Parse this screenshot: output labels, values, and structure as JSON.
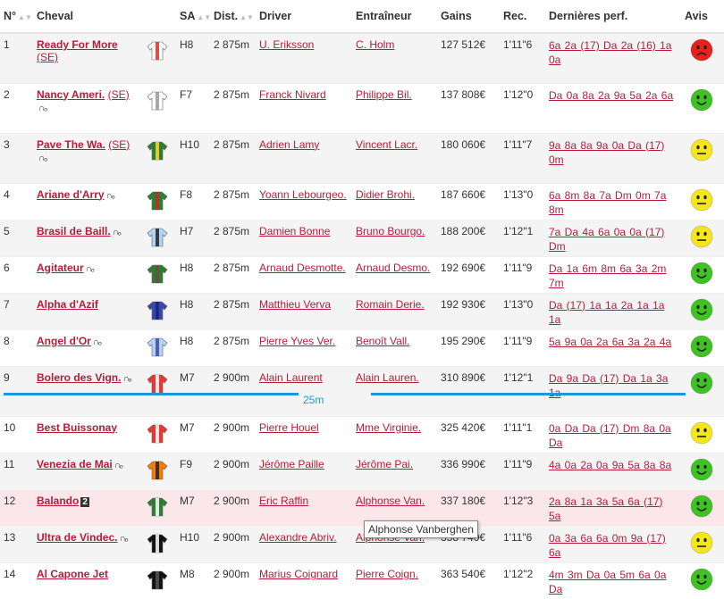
{
  "headers": {
    "num": "N°",
    "horse": "Cheval",
    "sa": "SA",
    "dist": "Dist.",
    "driver": "Driver",
    "trainer": "Entraîneur",
    "gains": "Gains",
    "rec": "Rec.",
    "perf": "Dernières perf.",
    "avis": "Avis"
  },
  "rows": [
    {
      "num": "1",
      "horse": "Ready For More",
      "origin": "(SE)",
      "shoe": "",
      "sa": "H8",
      "dist": "2 875m",
      "driver": "U. Eriksson",
      "trainer": "C. Holm",
      "gains": "127 512€",
      "rec": "1'11\"6",
      "perf": "6a 2a (17) Da 2a (16) 1a 0a",
      "avis": "red",
      "jersey": {
        "body": "#ffffff",
        "accent": "#d32f2f"
      }
    },
    {
      "num": "2",
      "horse": "Nancy Ameri.",
      "origin": "(SE)",
      "shoe": "∩ₒ",
      "sa": "F7",
      "dist": "2 875m",
      "driver": "Franck Nivard",
      "trainer": "Philippe Bil.",
      "gains": "137 808€",
      "rec": "1'12\"0",
      "perf": "Da 0a 8a 2a 9a 5a 2a 6a",
      "avis": "green",
      "jersey": {
        "body": "#ffffff",
        "accent": "#999999"
      }
    },
    {
      "num": "3",
      "horse": "Pave The Wa.",
      "origin": "(SE)",
      "shoe": "∩ₒ",
      "sa": "H10",
      "dist": "2 875m",
      "driver": "Adrien Lamy",
      "trainer": "Vincent Lacr.",
      "gains": "180 060€",
      "rec": "1'11\"7",
      "perf": "9a 8a 8a 9a 0a Da (17) 0m",
      "avis": "yellow",
      "jersey": {
        "body": "#2e7d32",
        "accent": "#fdd835"
      }
    },
    {
      "num": "4",
      "horse": "Ariane d'Arry",
      "origin": "",
      "shoe": "∩ₒ",
      "sa": "F8",
      "dist": "2 875m",
      "driver": "Yoann Lebourgeo.",
      "trainer": "Didier Brohi.",
      "gains": "187 660€",
      "rec": "1'13\"0",
      "perf": "6a 8m 8a 7a Dm 0m 7a 8m",
      "avis": "yellow",
      "jersey": {
        "body": "#2e7d32",
        "accent": "#c62828"
      }
    },
    {
      "num": "5",
      "horse": "Brasil de Baill.",
      "origin": "",
      "shoe": "∩ₒ",
      "sa": "H7",
      "dist": "2 875m",
      "driver": "Damien Bonne",
      "trainer": "Bruno Bourgo.",
      "gains": "188 200€",
      "rec": "1'12\"1",
      "perf": "7a Da 4a 6a 0a 0a (17) Dm",
      "avis": "yellow",
      "jersey": {
        "body": "#b3d4f5",
        "accent": "#222222"
      }
    },
    {
      "num": "6",
      "horse": "Agitateur",
      "origin": "",
      "shoe": "∩ₒ",
      "sa": "H8",
      "dist": "2 875m",
      "driver": "Arnaud Desmotte.",
      "trainer": "Arnaud Desmo.",
      "gains": "192 690€",
      "rec": "1'11\"9",
      "perf": "Da 1a 6m 8m 6a 3a 2m 7m",
      "avis": "green",
      "jersey": {
        "body": "#2e7d32",
        "accent": "#6d4c41"
      }
    },
    {
      "num": "7",
      "horse": "Alpha d'Azif",
      "origin": "",
      "shoe": "",
      "sa": "H8",
      "dist": "2 875m",
      "driver": "Matthieu Verva",
      "trainer": "Romain Derie.",
      "gains": "192 930€",
      "rec": "1'13\"0",
      "perf": "Da (17) 1a 1a 2a 1a 1a 1a",
      "avis": "green",
      "jersey": {
        "body": "#3949ab",
        "accent": "#1a237e"
      }
    },
    {
      "num": "8",
      "horse": "Angel d'Or",
      "origin": "",
      "shoe": "∩ₒ",
      "sa": "H8",
      "dist": "2 875m",
      "driver": "Pierre Yves Ver.",
      "trainer": "Benoît Vall.",
      "gains": "195 290€",
      "rec": "1'11\"9",
      "perf": "5a 9a 0a 2a 6a 3a 2a 4a",
      "avis": "green",
      "jersey": {
        "body": "#b3d4f5",
        "accent": "#3949ab"
      }
    },
    {
      "num": "9",
      "horse": "Bolero des Vign.",
      "origin": "",
      "shoe": "∩ₒ",
      "sa": "M7",
      "dist": "2 900m",
      "driver": "Alain Laurent",
      "trainer": "Alain Lauren.",
      "gains": "310 890€",
      "rec": "1'12\"1",
      "perf": "Da 9a Da (17) Da 1a 3a 1a",
      "avis": "green",
      "jersey": {
        "body": "#e53935",
        "accent": "#ffffff"
      }
    },
    {
      "num": "10",
      "horse": "Best Buissonay",
      "origin": "",
      "shoe": "",
      "sa": "M7",
      "dist": "2 900m",
      "driver": "Pierre Houel",
      "trainer": "Mme Virginie.",
      "gains": "325 420€",
      "rec": "1'11\"1",
      "perf": "0a Da Da (17) Dm 8a 0a Da",
      "avis": "yellow",
      "jersey": {
        "body": "#e53935",
        "accent": "#ffffff"
      }
    },
    {
      "num": "11",
      "horse": "Venezia de Mai",
      "origin": "",
      "shoe": "∩ₒ",
      "sa": "F9",
      "dist": "2 900m",
      "driver": "Jérôme Paille",
      "trainer": "Jérôme Pai.",
      "gains": "336 990€",
      "rec": "1'11\"9",
      "perf": "4a 0a 2a 0a 9a 5a 8a 8a",
      "avis": "green",
      "jersey": {
        "body": "#f57c00",
        "accent": "#222222"
      }
    },
    {
      "num": "12",
      "horse": "Balando",
      "origin": "",
      "shoe": "",
      "badge": "2",
      "sa": "M7",
      "dist": "2 900m",
      "driver": "Eric Raffin",
      "trainer": "Alphonse Van.",
      "gains": "337 180€",
      "rec": "1'12\"3",
      "perf": "2a 8a 1a 3a 5a 6a (17) 5a",
      "avis": "green",
      "jersey": {
        "body": "#2e7d32",
        "accent": "#ffffff"
      }
    },
    {
      "num": "13",
      "horse": "Ultra de Vindec.",
      "origin": "",
      "shoe": "∩ₒ",
      "sa": "H10",
      "dist": "2 900m",
      "driver": "Alexandre Abriv.",
      "trainer": "Alphonse Van.",
      "gains": "358 740€",
      "rec": "1'11\"6",
      "perf": "0a 3a 6a 6a 0m 9a (17) 6a",
      "avis": "yellow",
      "jersey": {
        "body": "#111111",
        "accent": "#ffffff"
      }
    },
    {
      "num": "14",
      "horse": "Al Capone Jet",
      "origin": "",
      "shoe": "",
      "sa": "M8",
      "dist": "2 900m",
      "driver": "Marius Coignard",
      "trainer": "Pierre Coign.",
      "gains": "363 540€",
      "rec": "1'12\"2",
      "perf": "4m 3m Da 0a 5m 6a 0a Da",
      "avis": "green",
      "jersey": {
        "body": "#111111",
        "accent": "#555555"
      }
    }
  ],
  "distance_marker": {
    "label": "25m",
    "color": "#1a9bd8"
  },
  "tooltip": "Alphonse Vanberghen",
  "colors": {
    "link": "#b31d3a",
    "row_alt": "#f4f4f4",
    "row_highlight": "#fbe6ea",
    "smiley_green": "#3fc224",
    "smiley_yellow": "#f5e51b",
    "smiley_red": "#e8221b"
  }
}
